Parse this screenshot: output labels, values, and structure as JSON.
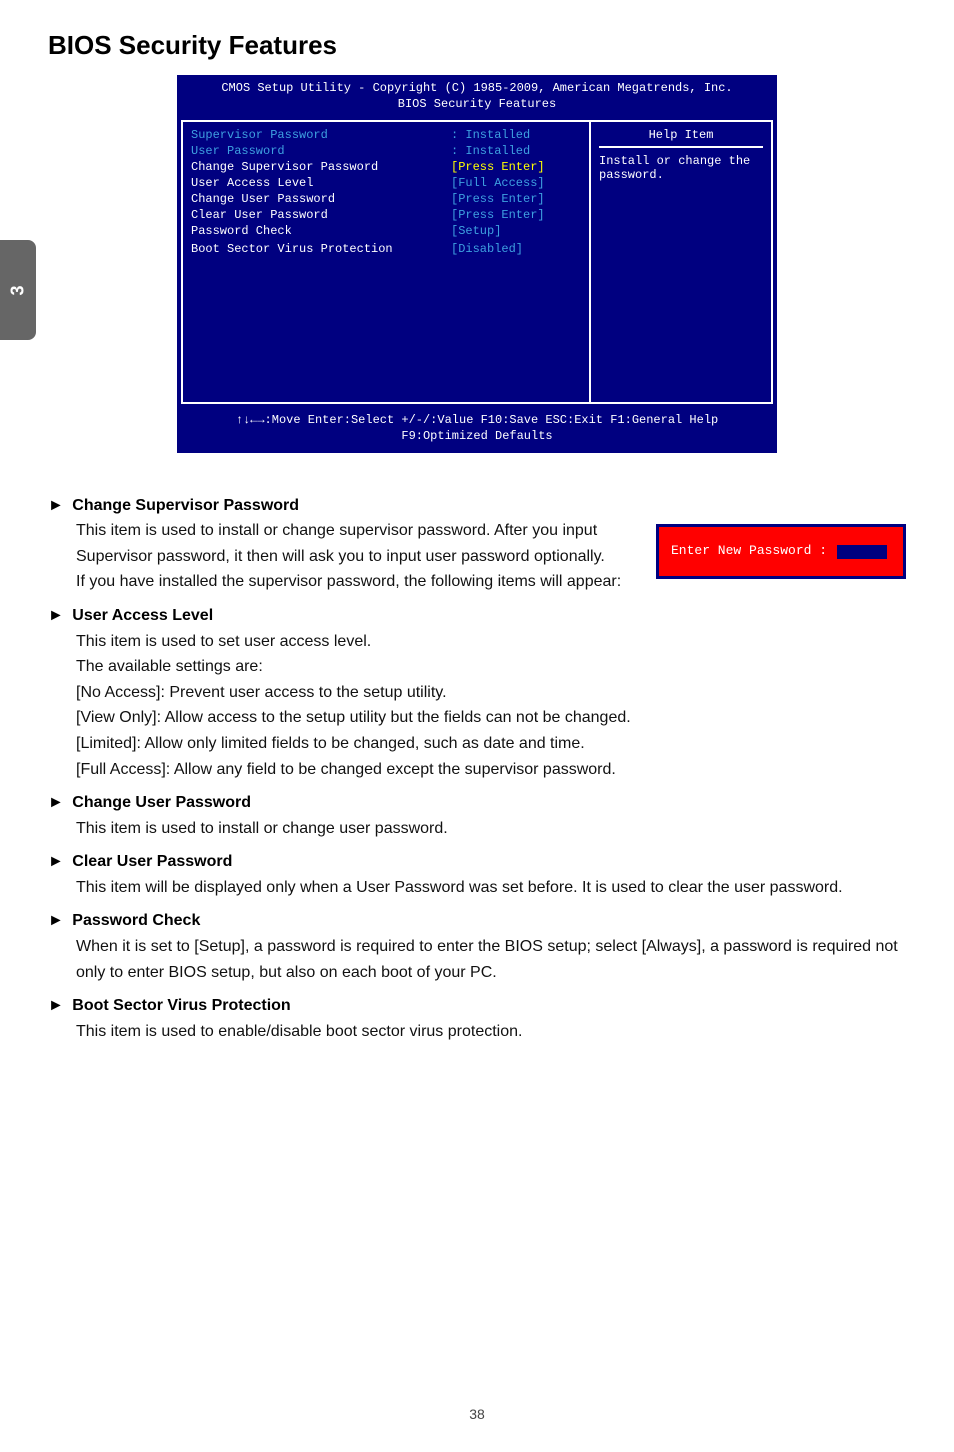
{
  "page": {
    "title": "BIOS Security Features",
    "side_tab": "3",
    "page_number": "38"
  },
  "bios": {
    "header_line1": "CMOS Setup Utility - Copyright (C) 1985-2009, American Megatrends, Inc.",
    "header_line2": "BIOS Security Features",
    "rows": [
      {
        "label": "Supervisor Password",
        "value": ": Installed",
        "label_class": "cyan",
        "value_class": "cyan"
      },
      {
        "label": "User Password",
        "value": ": Installed",
        "label_class": "cyan",
        "value_class": "cyan"
      },
      {
        "label": "Change Supervisor Password",
        "value": "[Press Enter]",
        "label_class": "white",
        "value_class": "yellow"
      },
      {
        "label": "User Access Level",
        "value": "[Full Access]",
        "label_class": "white",
        "value_class": "cyan"
      },
      {
        "label": "Change User Password",
        "value": "[Press Enter]",
        "label_class": "white",
        "value_class": "cyan"
      },
      {
        "label": "Clear User Password",
        "value": "[Press Enter]",
        "label_class": "white",
        "value_class": "cyan"
      },
      {
        "label": "Password Check",
        "value": "[Setup]",
        "label_class": "white",
        "value_class": "cyan"
      },
      {
        "label": "",
        "value": "",
        "label_class": "white",
        "value_class": "white"
      },
      {
        "label": "Boot Sector Virus Protection",
        "value": "[Disabled]",
        "label_class": "white",
        "value_class": "cyan"
      }
    ],
    "help_title": "Help Item",
    "help_text": "Install or change the password.",
    "footer_line1": "↑↓←→:Move   Enter:Select    +/-/:Value    F10:Save    ESC:Exit    F1:General Help",
    "footer_line2": "F9:Optimized Defaults"
  },
  "dialog": {
    "label": "Enter New Password :"
  },
  "sections": [
    {
      "title": "Change Supervisor Password",
      "paragraphs": [
        "This item is used to install or change supervisor password. After you input Supervisor password, it then will ask you to input user password optionally.",
        "If you have installed the supervisor password, the following items will appear:"
      ],
      "show_dialog": true
    },
    {
      "title": "User Access Level",
      "paragraphs": [
        "This item is used to set user access level.",
        "The available settings are:",
        "[No Access]: Prevent user access to the setup utility.",
        "[View Only]: Allow access to the setup utility but the fields can not be changed.",
        "[Limited]: Allow only limited fields to be changed, such as date and time.",
        "[Full Access]: Allow any field to be changed except the supervisor password."
      ]
    },
    {
      "title": "Change User Password",
      "paragraphs": [
        "This item is used to install or change user password."
      ]
    },
    {
      "title": "Clear User Password",
      "paragraphs": [
        "This item will be displayed only when a User Password was set before. It is used to clear the user password."
      ]
    },
    {
      "title": "Password Check",
      "paragraphs": [
        "When it is set to [Setup], a password is required to enter the BIOS setup; select [Always], a password is required not only to enter BIOS setup, but also on each boot of your PC."
      ]
    },
    {
      "title": "Boot Sector Virus Protection",
      "paragraphs": [
        "This item is used to enable/disable boot sector virus protection."
      ]
    }
  ]
}
